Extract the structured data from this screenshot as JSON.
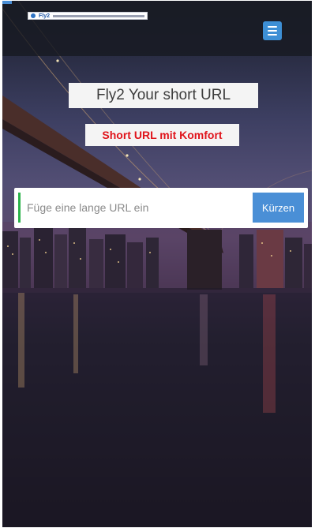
{
  "header": {
    "logo_text": "Fly2",
    "menu_icon": "hamburger-menu-icon"
  },
  "hero": {
    "title": "Fly2 Your short URL",
    "subtitle": "Short URL mit Komfort"
  },
  "shortener": {
    "input_placeholder": "Füge eine lange URL ein",
    "input_value": "",
    "button_label": "Kürzen"
  },
  "colors": {
    "accent_blue": "#4a8fd6",
    "subtitle_red": "#e0141b",
    "input_accent_green": "#2bb34a"
  }
}
